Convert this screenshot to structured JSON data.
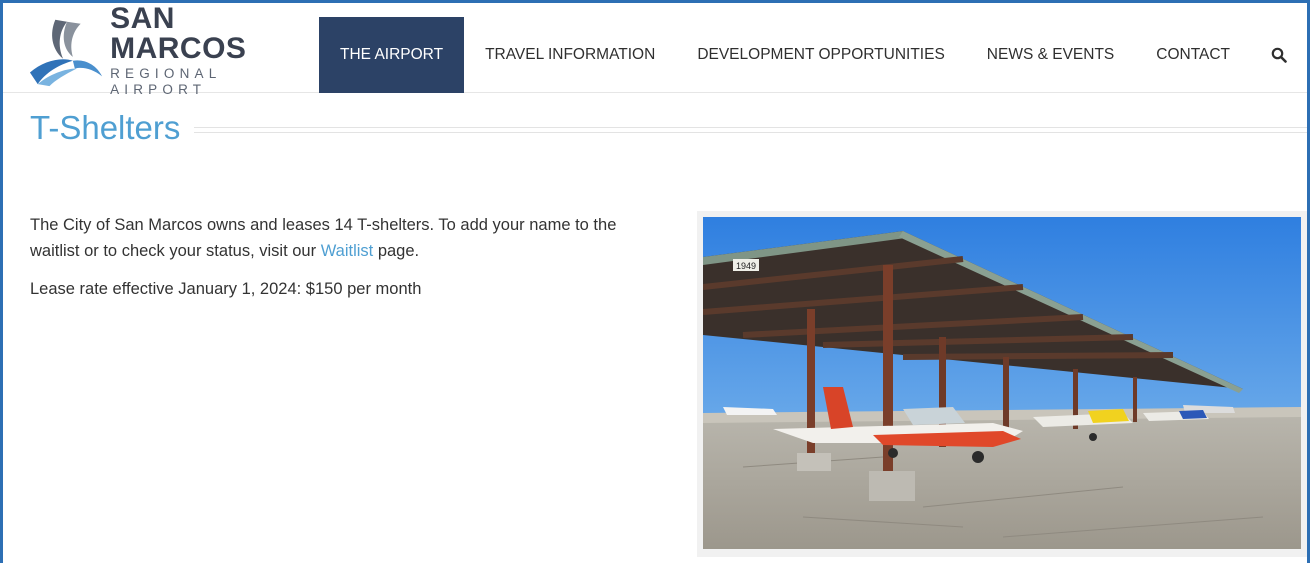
{
  "logo": {
    "name": "SAN MARCOS",
    "subtitle": "REGIONAL AIRPORT"
  },
  "nav": {
    "items": [
      {
        "label": "THE AIRPORT",
        "active": true
      },
      {
        "label": "TRAVEL INFORMATION",
        "active": false
      },
      {
        "label": "DEVELOPMENT OPPORTUNITIES",
        "active": false
      },
      {
        "label": "NEWS & EVENTS",
        "active": false
      },
      {
        "label": "CONTACT",
        "active": false
      }
    ],
    "search_icon": "search-icon"
  },
  "page": {
    "title": "T-Shelters",
    "intro_before": "The City of San Marcos owns and leases 14 T-shelters. To add your name to the waitlist or to check your status, visit our ",
    "waitlist_link": "Waitlist",
    "intro_after": " page.",
    "lease_rate": "Lease rate effective January 1, 2024: $150 per month"
  },
  "photo": {
    "hangar_number": "1949"
  },
  "colors": {
    "frame": "#2d6fb4",
    "nav_active_bg": "#2c4266",
    "title": "#4f9fd2",
    "link": "#4f9fd2"
  }
}
